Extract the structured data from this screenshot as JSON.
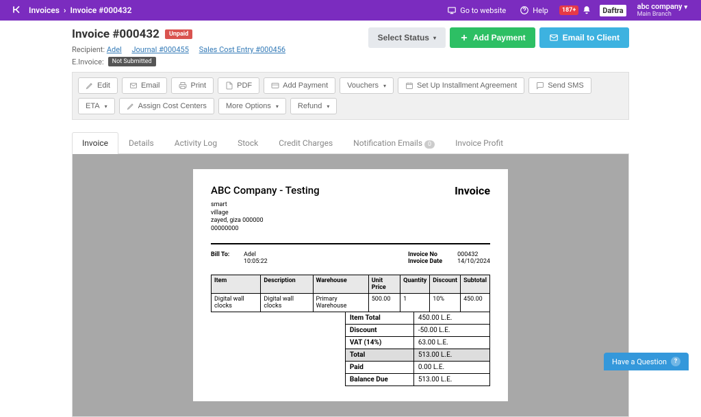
{
  "topbar": {
    "breadcrumb_root": "Invoices",
    "breadcrumb_current": "Invoice #000432",
    "go_to_website": "Go to website",
    "help": "Help",
    "notif_count": "187+",
    "logo": "Daftra",
    "company_name": "abc company",
    "branch": "Main Branch"
  },
  "header": {
    "title": "Invoice #000432",
    "status_badge": "Unpaid",
    "recipient_label": "Recipient:",
    "recipient": "Adel",
    "journal": "Journal #000455",
    "sales_entry": "Sales Cost Entry #000456",
    "e_invoice_label": "E.Invoice:",
    "e_invoice_status": "Not Submitted",
    "btn_select_status": "Select Status",
    "btn_add_payment": "Add Payment",
    "btn_email_client": "Email to Client"
  },
  "toolbar": {
    "edit": "Edit",
    "email": "Email",
    "print": "Print",
    "pdf": "PDF",
    "add_payment": "Add Payment",
    "vouchers": "Vouchers",
    "set_up_installment": "Set Up Installment Agreement",
    "send_sms": "Send SMS",
    "eta": "ETA",
    "assign_cost_centers": "Assign Cost Centers",
    "more_options": "More Options",
    "refund": "Refund"
  },
  "tabs": {
    "invoice": "Invoice",
    "details": "Details",
    "activity_log": "Activity Log",
    "stock": "Stock",
    "credit_charges": "Credit Charges",
    "notification_emails": "Notification Emails",
    "notification_count": "0",
    "invoice_profit": "Invoice Profit"
  },
  "invoice": {
    "company": "ABC Company - Testing",
    "doc_word": "Invoice",
    "address_l1": "smart",
    "address_l2": "village",
    "address_l3": "zayed, giza 000000",
    "address_l4": "00000000",
    "bill_to_label": "Bill To:",
    "bill_to_name": "Adel",
    "bill_to_time": "10:05:22",
    "no_label": "Invoice No",
    "no_value": "000432",
    "date_label": "Invoice Date",
    "date_value": "14/10/2024",
    "th_item": "Item",
    "th_desc": "Description",
    "th_wh": "Warehouse",
    "th_unit": "Unit Price",
    "th_qty": "Quantity",
    "th_disc": "Discount",
    "th_sub": "Subtotal",
    "row_item": "Digital wall clocks",
    "row_desc": "Digital wall clocks",
    "row_wh": "Primary Warehouse",
    "row_unit": "500.00",
    "row_qty": "1",
    "row_disc": "10%",
    "row_sub": "450.00",
    "t_item_total_k": "Item Total",
    "t_item_total_v": "450.00 L.E.",
    "t_discount_k": "Discount",
    "t_discount_v": "-50.00 L.E.",
    "t_vat_k": "VAT (14%)",
    "t_vat_v": "63.00 L.E.",
    "t_total_k": "Total",
    "t_total_v": "513.00 L.E.",
    "t_paid_k": "Paid",
    "t_paid_v": "0.00 L.E.",
    "t_balance_k": "Balance Due",
    "t_balance_v": "513.00 L.E."
  },
  "help_float": "Have a Question"
}
